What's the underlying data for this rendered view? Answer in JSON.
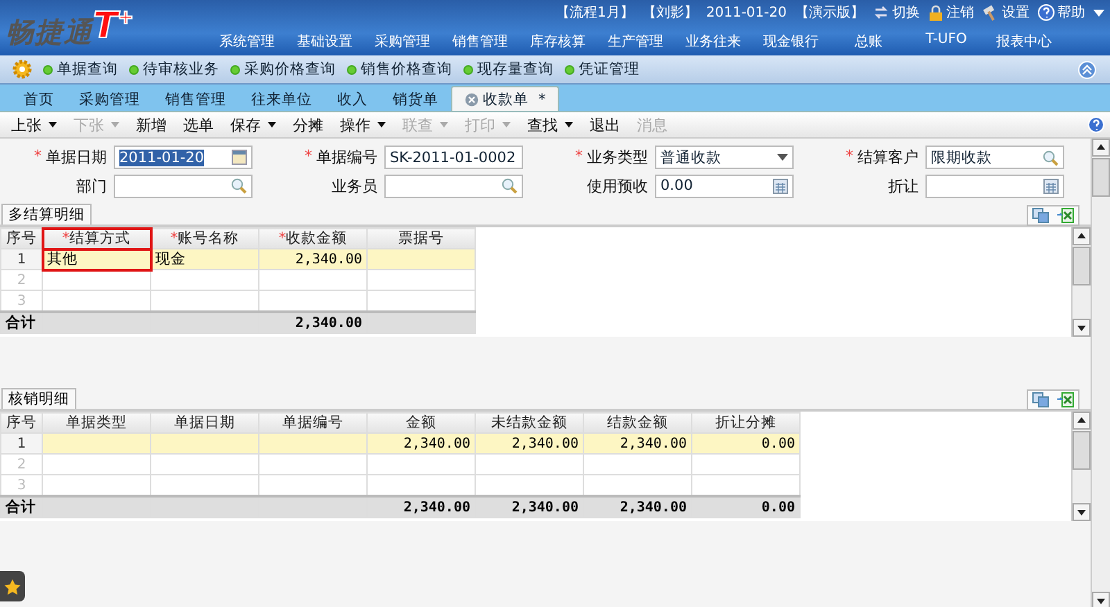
{
  "header": {
    "logo": {
      "name": "畅捷通",
      "mark": "T",
      "plus": "+"
    },
    "info": [
      "【流程1月】",
      "【刘影】",
      "2011-01-20",
      "【演示版】"
    ],
    "actions": [
      {
        "label": "切换",
        "kind": "switch"
      },
      {
        "label": "注销",
        "kind": "lock"
      },
      {
        "label": "设置",
        "kind": "settings"
      },
      {
        "label": "帮助",
        "kind": "help"
      }
    ],
    "menu": [
      "系统管理",
      "基础设置",
      "采购管理",
      "销售管理",
      "库存核算",
      "生产管理",
      "业务往来",
      "现金银行",
      "总账",
      "T-UFO",
      "报表中心"
    ]
  },
  "quick_links": [
    "单据查询",
    "待审核业务",
    "采购价格查询",
    "销售价格查询",
    "现存量查询",
    "凭证管理"
  ],
  "tabs": [
    {
      "label": "首页",
      "selected": false
    },
    {
      "label": "采购管理",
      "selected": false
    },
    {
      "label": "销售管理",
      "selected": false
    },
    {
      "label": "往来单位",
      "selected": false
    },
    {
      "label": "收入",
      "selected": false
    },
    {
      "label": "销货单",
      "selected": false
    },
    {
      "label": "收款单",
      "selected": true,
      "closable": true,
      "suffix": "*"
    }
  ],
  "toolbar": [
    {
      "label": "上张",
      "dropdown": true,
      "disabled": false
    },
    {
      "label": "下张",
      "dropdown": true,
      "disabled": true
    },
    {
      "label": "新增",
      "dropdown": false,
      "disabled": false
    },
    {
      "label": "选单",
      "dropdown": false,
      "disabled": false
    },
    {
      "label": "保存",
      "dropdown": true,
      "disabled": false
    },
    {
      "label": "分摊",
      "dropdown": false,
      "disabled": false
    },
    {
      "label": "操作",
      "dropdown": true,
      "disabled": false
    },
    {
      "label": "联查",
      "dropdown": true,
      "disabled": true
    },
    {
      "label": "打印",
      "dropdown": true,
      "disabled": true
    },
    {
      "label": "查找",
      "dropdown": true,
      "disabled": false
    },
    {
      "label": "退出",
      "dropdown": false,
      "disabled": false
    },
    {
      "label": "消息",
      "dropdown": false,
      "disabled": true
    }
  ],
  "form": [
    {
      "label": "单据日期",
      "required": true,
      "kind": "date",
      "value": "2011-01-20"
    },
    {
      "label": "单据编号",
      "required": true,
      "kind": "text",
      "value": "SK-2011-01-0002"
    },
    {
      "label": "业务类型",
      "required": true,
      "kind": "select",
      "value": "普通收款"
    },
    {
      "label": "结算客户",
      "required": true,
      "kind": "lookup",
      "value": "限期收款"
    },
    {
      "label": "部门",
      "required": false,
      "kind": "lookup"
    },
    {
      "label": "业务员",
      "required": false,
      "kind": "lookup"
    },
    {
      "label": "使用预收",
      "required": false,
      "kind": "calc",
      "value": "0.00"
    },
    {
      "label": "折让",
      "required": false,
      "kind": "calc"
    }
  ],
  "grids": [
    {
      "title": "多结算明细",
      "columns": [
        {
          "label": "序号",
          "required": false,
          "focused": false
        },
        {
          "label": "结算方式",
          "required": true,
          "focused": true
        },
        {
          "label": "账号名称",
          "required": true,
          "focused": false
        },
        {
          "label": "收款金额",
          "required": true,
          "focused": false
        },
        {
          "label": "票据号",
          "required": false,
          "focused": false
        }
      ],
      "rows": [
        {
          "selected": true,
          "cells": [
            "1",
            "其他",
            "现金",
            "2,340.00",
            ""
          ]
        },
        {
          "selected": false,
          "cells": [
            "2",
            "",
            "",
            "",
            ""
          ]
        },
        {
          "selected": false,
          "cells": [
            "3",
            "",
            "",
            "",
            ""
          ]
        }
      ],
      "total": {
        "cells": [
          "合计",
          "",
          "",
          "2,340.00",
          ""
        ]
      }
    },
    {
      "title": "核销明细",
      "columns": [
        {
          "label": "序号",
          "required": false,
          "focused": false
        },
        {
          "label": "单据类型",
          "required": false,
          "focused": false
        },
        {
          "label": "单据日期",
          "required": false,
          "focused": false
        },
        {
          "label": "单据编号",
          "required": false,
          "focused": false
        },
        {
          "label": "金额",
          "required": false,
          "focused": false
        },
        {
          "label": "未结款金额",
          "required": false,
          "focused": false
        },
        {
          "label": "结款金额",
          "required": false,
          "focused": false
        },
        {
          "label": "折让分摊",
          "required": false,
          "focused": false
        }
      ],
      "rows": [
        {
          "selected": true,
          "cells": [
            "1",
            "",
            "",
            "",
            "2,340.00",
            "2,340.00",
            "2,340.00",
            "0.00"
          ]
        },
        {
          "selected": false,
          "cells": [
            "2",
            "",
            "",
            "",
            "",
            "",
            "",
            ""
          ]
        },
        {
          "selected": false,
          "cells": [
            "3",
            "",
            "",
            "",
            "",
            "",
            "",
            ""
          ]
        }
      ],
      "total": {
        "cells": [
          "合计",
          "",
          "",
          "",
          "2,340.00",
          "2,340.00",
          "2,340.00",
          "0.00"
        ]
      }
    }
  ]
}
